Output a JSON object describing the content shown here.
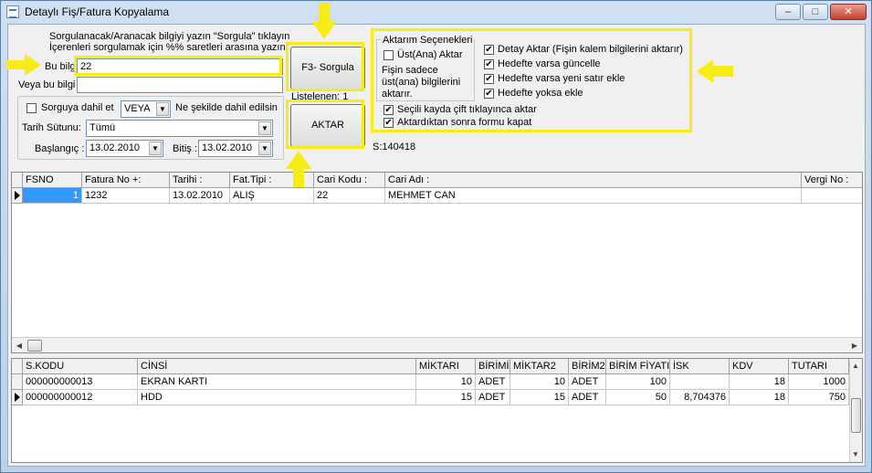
{
  "window": {
    "title": "Detaylı Fiş/Fatura Kopyalama",
    "minimize_label": "–",
    "maximize_label": "□",
    "close_label": "✕"
  },
  "search": {
    "instructions_line1": "Sorgulanacak/Aranacak bilgiyi yazın \"Sorgula\" tıklayın",
    "instructions_line2": "İçerenleri sorgulamak için %% saretleri arasına yazın.",
    "bu_bilgi_label": "Bu bilgi",
    "bu_bilgi_value": "22",
    "veya_label": "Veya bu bilgi",
    "veya_value": "",
    "include_label": "Sorguya dahil et",
    "logic_value": "VEYA",
    "logic_caption": "Ne şekilde dahil edilsin",
    "date_column_label": "Tarih Sütunu:",
    "date_column_value": "Tümü",
    "start_label": "Başlangıç :",
    "start_value": "13.02.2010",
    "end_label": "Bitiş :",
    "end_value": "13.02.2010"
  },
  "actions": {
    "query_button": "F3- Sorgula",
    "listed_label": "Listelenen: 1",
    "transfer_button": "AKTAR",
    "status": "S:140418"
  },
  "options": {
    "group_title": "Aktarım Seçenekleri",
    "header_only_label": "Üst(Ana) Aktar",
    "header_only_checked": false,
    "header_note": "Fişin sadece üst(ana) bilgilerini aktarır.",
    "detail_label": "Detay Aktar (Fişin kalem bilgilerini aktarır)",
    "update_label": "Hedefte varsa güncelle",
    "add_row_label": "Hedefte varsa yeni satır ekle",
    "add_missing_label": "Hedefte yoksa ekle",
    "dblclick_label": "Seçili kayda çift tıklayınca aktar",
    "close_after_label": "Aktardıktan sonra formu kapat",
    "checked_mark": "✔"
  },
  "top_grid": {
    "columns": [
      "FSNO",
      "Fatura No +:",
      "Tarihi :",
      "Fat.Tipi :",
      "Cari Kodu :",
      "Cari Adı :",
      "Vergi No :"
    ],
    "rows": [
      {
        "fsno": "1",
        "fatura_no": "1232",
        "tarihi": "13.02.2010",
        "fat_tipi": "ALIŞ",
        "cari_kodu": "22",
        "cari_adi": "MEHMET CAN",
        "vergi_no": ""
      }
    ]
  },
  "bottom_grid": {
    "columns": [
      "S.KODU",
      "CİNSİ",
      "MİKTARI",
      "BİRİMİ",
      "MİKTAR2",
      "BİRİM2",
      "BİRİM FİYATI",
      "İSK",
      "KDV",
      "TUTARI"
    ],
    "rows": [
      {
        "skodu": "000000000013",
        "cinsi": "EKRAN KARTI",
        "miktari": "10",
        "birimi": "ADET",
        "miktar2": "10",
        "birim2": "ADET",
        "fiyat": "100",
        "isk": "",
        "kdv": "18",
        "tutari": "1000"
      },
      {
        "skodu": "000000000012",
        "cinsi": "HDD",
        "miktari": "15",
        "birimi": "ADET",
        "miktar2": "15",
        "birim2": "ADET",
        "fiyat": "50",
        "isk": "8,704376",
        "kdv": "18",
        "tutari": "750"
      }
    ]
  },
  "colors": {
    "highlight": "#f7ec16",
    "selection": "#3399ff"
  }
}
